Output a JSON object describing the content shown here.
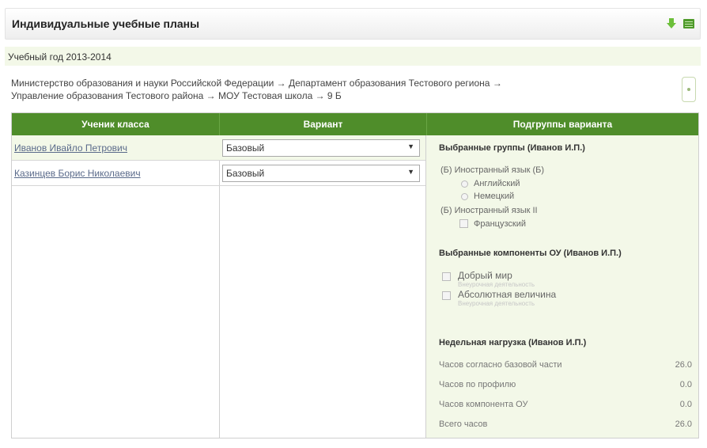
{
  "header": {
    "title": "Индивидуальные учебные планы",
    "icons": [
      "download-arrow-icon",
      "excel-icon"
    ]
  },
  "year_bar": {
    "text": "Учебный год 2013-2014"
  },
  "breadcrumb": {
    "line1": "Министерство образования и науки Российской Федерации → Департамент образования Тестового региона →",
    "line2": "Управление образования Тестового района → МОУ Тестовая школа → 9 Б",
    "collapse_icon": "collapse-icon"
  },
  "table": {
    "columns": [
      "Ученик класса",
      "Вариант",
      "Подгруппы варианта"
    ],
    "rows": [
      {
        "student": "Иванов Ивайло Петрович",
        "variant": "Базовый"
      },
      {
        "student": "Казинцев Борис Николаевич",
        "variant": "Базовый"
      }
    ]
  },
  "subgroups": {
    "selected_groups_title": "Выбранные группы (Иванов И.П.)",
    "group1_label": "(Б) Иностранный язык (Б)",
    "group1_options": [
      "Английский",
      "Немецкий"
    ],
    "group2_label": "(Б) Иностранный язык II",
    "group2_options": [
      "Французский"
    ],
    "components_title": "Выбранные компоненты ОУ (Иванов И.П.)",
    "components": [
      {
        "label": "Добрый мир",
        "note": "Внеурочная деятельность"
      },
      {
        "label": "Абсолютная величина",
        "note": "Внеурочная деятельность"
      }
    ],
    "load_title": "Недельная нагрузка (Иванов И.П.)",
    "load": [
      {
        "label": "Часов согласно базовой части",
        "value": "26.0"
      },
      {
        "label": "Часов по профилю",
        "value": "0.0"
      },
      {
        "label": "Часов компонента ОУ",
        "value": "0.0"
      },
      {
        "label": "Всего часов",
        "value": "26.0"
      }
    ]
  },
  "colors": {
    "header_green": "#4f8d2a",
    "highlight_bg": "#f3f8e8",
    "link": "#5a6a8a"
  }
}
